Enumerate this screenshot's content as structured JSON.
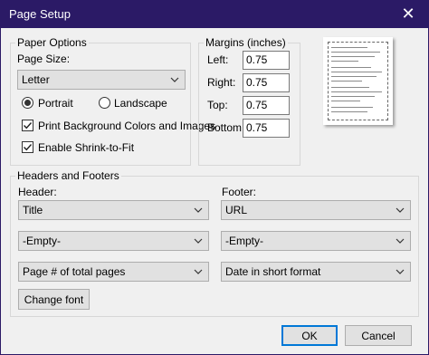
{
  "window": {
    "title": "Page Setup",
    "close_glyph": "✕"
  },
  "paper_options": {
    "legend": "Paper Options",
    "page_size_label": "Page Size:",
    "page_size_value": "Letter",
    "orientation": {
      "portrait": "Portrait",
      "landscape": "Landscape",
      "selected": "portrait"
    },
    "print_background": {
      "label": "Print Background Colors and Images",
      "checked": true
    },
    "shrink_to_fit": {
      "label": "Enable Shrink-to-Fit",
      "checked": true
    }
  },
  "margins": {
    "legend": "Margins (inches)",
    "left_label": "Left:",
    "left_value": "0.75",
    "right_label": "Right:",
    "right_value": "0.75",
    "top_label": "Top:",
    "top_value": "0.75",
    "bottom_label": "Bottom:",
    "bottom_value": "0.75"
  },
  "headers_footers": {
    "legend": "Headers and Footers",
    "header_label": "Header:",
    "footer_label": "Footer:",
    "header_values": [
      "Title",
      "-Empty-",
      "Page # of total pages"
    ],
    "footer_values": [
      "URL",
      "-Empty-",
      "Date in short format"
    ],
    "change_font": "Change font"
  },
  "buttons": {
    "ok": "OK",
    "cancel": "Cancel"
  },
  "colors": {
    "titlebar": "#2b1a66",
    "default_button_border": "#0078d7"
  }
}
